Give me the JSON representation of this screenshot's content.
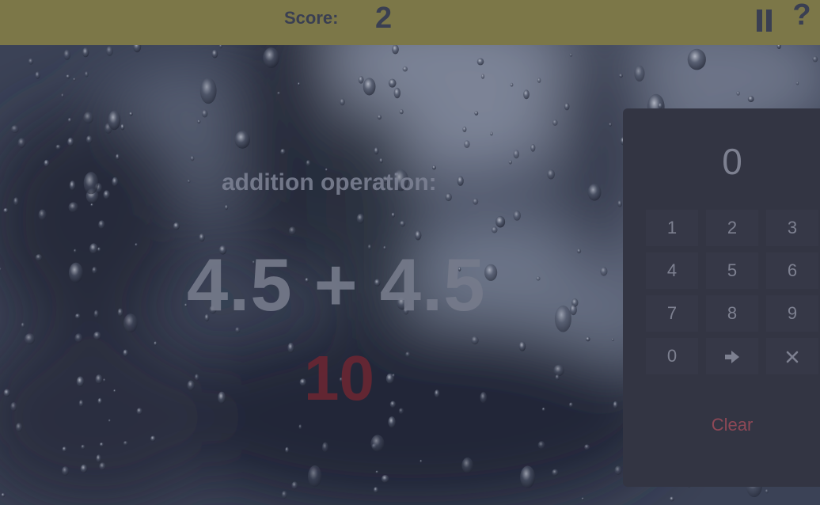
{
  "header": {
    "score_label": "Score:",
    "score_value": "2",
    "pause_icon": "pause-icon",
    "help_label": "?"
  },
  "game": {
    "operation_label": "addition operation:",
    "expression": "4.5 + 4.5",
    "falling_answer": "10",
    "background": "rainy-window"
  },
  "keypad": {
    "display": "0",
    "keys": [
      "1",
      "2",
      "3",
      "4",
      "5",
      "6",
      "7",
      "8",
      "9",
      "0"
    ],
    "submit_icon": "arrow-right-icon",
    "delete_icon": "close-icon",
    "clear_label": "Clear"
  },
  "colors": {
    "topbar": "#7c7748",
    "panel": "#333543",
    "answer": "#6e2632",
    "clear": "#8e4856"
  }
}
